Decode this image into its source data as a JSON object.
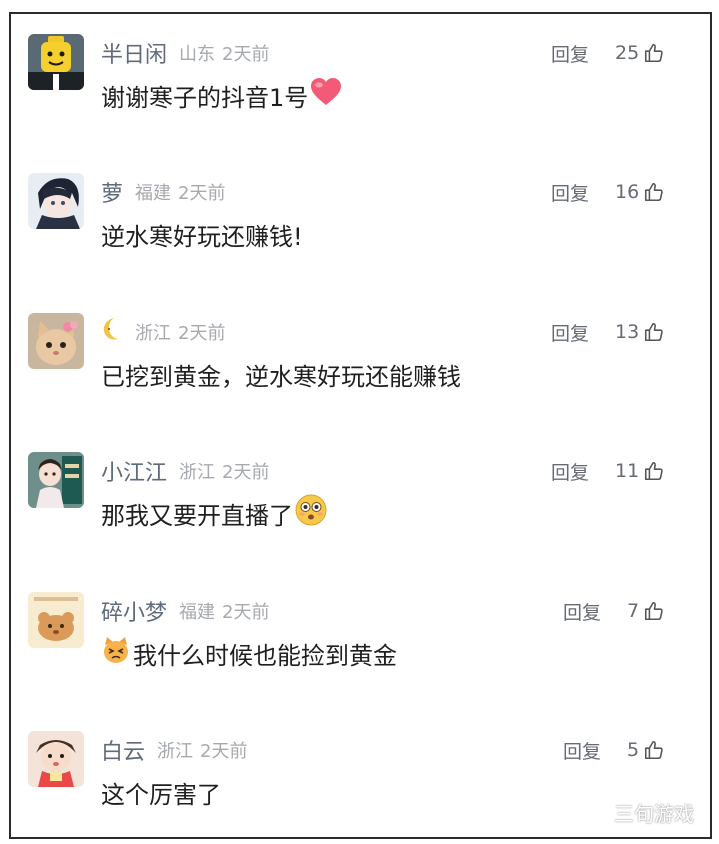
{
  "comments": [
    {
      "username": "半日闲",
      "location": "山东",
      "time": "2天前",
      "reply_label": "回复",
      "likes": "25",
      "text": "谢谢寒子的抖音1号",
      "emoji": "heart-emoji"
    },
    {
      "username": "萝",
      "location": "福建",
      "time": "2天前",
      "reply_label": "回复",
      "likes": "16",
      "text": "逆水寒好玩还赚钱!",
      "emoji": ""
    },
    {
      "username": "",
      "username_icon": "moon-icon",
      "location": "浙江",
      "time": "2天前",
      "reply_label": "回复",
      "likes": "13",
      "text": "已挖到黄金，逆水寒好玩还能赚钱",
      "emoji": ""
    },
    {
      "username": "小江江",
      "location": "浙江",
      "time": "2天前",
      "reply_label": "回复",
      "likes": "11",
      "text": "那我又要开直播了",
      "emoji": "flushed-face-emoji"
    },
    {
      "username": "碎小梦",
      "location": "福建",
      "time": "2天前",
      "reply_label": "回复",
      "likes": "7",
      "text": "我什么时候也能捡到黄金",
      "emoji": "cat-face-emoji"
    },
    {
      "username": "白云",
      "location": "浙江",
      "time": "2天前",
      "reply_label": "回复",
      "likes": "5",
      "text": "这个厉害了",
      "emoji": ""
    }
  ],
  "watermark": "三旬游戏",
  "colors": {
    "username": "#5f6a7a",
    "meta": "#a6a9ad",
    "text": "#1f1f1f",
    "action": "#666b73",
    "border": "#2b2b2b"
  }
}
